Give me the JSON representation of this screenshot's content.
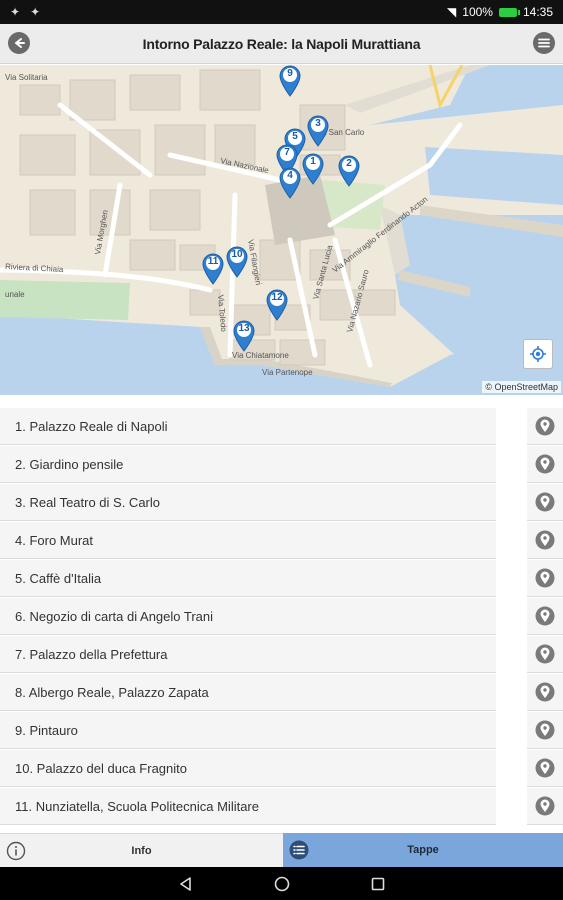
{
  "status_bar": {
    "battery": "100%",
    "time": "14:35"
  },
  "header": {
    "title": "Intorno Palazzo Reale: la Napoli Murattiana"
  },
  "map": {
    "attribution": "© OpenStreetMap",
    "street_labels": [
      "Via Nazionale",
      "Via Ammiraglio Ferdinando Acton",
      "Via Chiatamone",
      "Riviera di Chiaia",
      "Via Santa Lucia",
      "Via Nazario Sauro",
      "Via Partenope",
      "Via San Carlo",
      "Via Toledo",
      "Via Filangieri",
      "Via Morghen",
      "Via Solitaria",
      "unale"
    ],
    "markers": [
      "9",
      "5",
      "3",
      "7",
      "1",
      "2",
      "4",
      "10",
      "11",
      "12",
      "13"
    ]
  },
  "stops": [
    "1. Palazzo Reale di Napoli",
    "2. Giardino pensile",
    "3. Real Teatro di S. Carlo",
    "4. Foro Murat",
    "5. Caffè d'Italia",
    "6. Negozio di carta di Angelo Trani",
    "7. Palazzo della Prefettura",
    "8. Albergo Reale, Palazzo Zapata",
    "9. Pintauro",
    "10. Palazzo del duca Fragnito",
    "11. Nunziatella, Scuola Politecnica Militare"
  ],
  "tabs": {
    "info": "Info",
    "tappe": "Tappe"
  },
  "colors": {
    "marker": "#2f7fd0",
    "active_tab": "#7aa6dc",
    "sea": "#b9d3ec",
    "land": "#efe9dc"
  }
}
